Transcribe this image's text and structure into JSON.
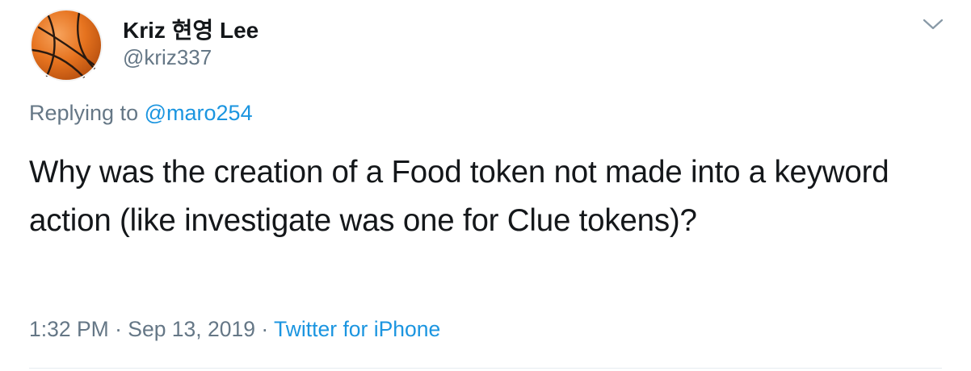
{
  "user": {
    "display_name": "Kriz 현영 Lee",
    "handle": "@kriz337",
    "avatar_icon": "basketball-icon"
  },
  "reply": {
    "prefix": "Replying to",
    "mention": "@maro254"
  },
  "tweet": {
    "text": "Why was the creation of a Food token not made into a keyword action (like investigate was one for Clue tokens)?"
  },
  "meta": {
    "time": "1:32 PM",
    "separator": "·",
    "date": "Sep 13, 2019",
    "source": "Twitter for iPhone"
  },
  "icons": {
    "menu": "chevron-down-icon"
  },
  "colors": {
    "link": "#1b95e0",
    "secondary_text": "#657786",
    "primary_text": "#14171a",
    "divider": "#e6ecf0"
  }
}
